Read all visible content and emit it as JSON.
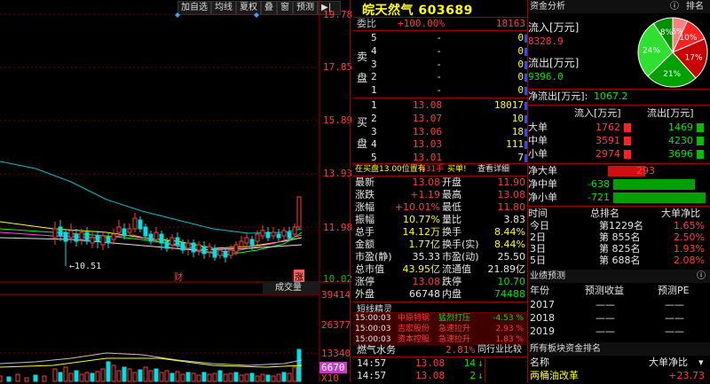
{
  "toolbar": {
    "buttons": [
      "加自选",
      "均线",
      "夏权",
      "叠",
      "窗",
      "预测"
    ],
    "arrow": "▶|"
  },
  "kchart": {
    "price_axis": [
      "19.78",
      "17.85",
      "15.89",
      "13.93",
      "11.98",
      "10.02"
    ],
    "low_label": "←10.51",
    "mark_cai": "财",
    "mark_zhang": "涨",
    "vol_title": "成交量",
    "vol_axis": [
      "39414",
      "26377",
      "13340",
      "6670",
      "X10"
    ]
  },
  "quote": {
    "title": "皖天然气 603689",
    "weibi": {
      "label": "委比",
      "pct": "+100.00%",
      "val": "18163"
    },
    "sell": [
      {
        "n": "5",
        "p": "-",
        "v": "0"
      },
      {
        "n": "4",
        "p": "-",
        "v": "0"
      },
      {
        "n": "3",
        "p": "-",
        "v": "0"
      },
      {
        "n": "2",
        "p": "-",
        "v": "0"
      },
      {
        "n": "1",
        "p": "-",
        "v": "0"
      }
    ],
    "sell_label": [
      "卖",
      "盘"
    ],
    "buy_label": [
      "买",
      "盘"
    ],
    "buy": [
      {
        "n": "1",
        "p": "13.08",
        "v": "18017"
      },
      {
        "n": "2",
        "p": "13.07",
        "v": "10"
      },
      {
        "n": "3",
        "p": "13.06",
        "v": "18"
      },
      {
        "n": "4",
        "p": "13.03",
        "v": "111"
      },
      {
        "n": "5",
        "p": "13.01",
        "v": "7"
      }
    ],
    "notice": {
      "a": "在买盘13.00位置有",
      "b": "631手",
      "c": "买单!",
      "d": "查看详细"
    },
    "stats": [
      [
        "最新",
        "13.08",
        "开盘",
        "11.90"
      ],
      [
        "涨跌",
        "+1.19",
        "最高",
        "13.08"
      ],
      [
        "涨幅",
        "+10.01%",
        "最低",
        "11.80"
      ],
      [
        "振幅",
        "10.77%",
        "量比",
        "3.83"
      ],
      [
        "总手",
        "14.12万",
        "换手",
        "8.44%"
      ],
      [
        "金额",
        "1.77亿",
        "换手(实)",
        "8.44%"
      ],
      [
        "市盈(静)",
        "35.33",
        "市盈(动)",
        "25.50"
      ],
      [
        "总市值",
        "43.95亿",
        "流通值",
        "21.89亿"
      ],
      [
        "涨停",
        "13.08",
        "跌停",
        "10.70"
      ],
      [
        "外盘",
        "66748",
        "内盘",
        "74488"
      ]
    ],
    "short": {
      "title": "短线精灵",
      "rows": [
        [
          "15:00:03",
          "中原特钢",
          "猛烈打压",
          "-4.53 %"
        ],
        [
          "15:00:03",
          "吉宏股份",
          "急速拉升",
          "2.93 %"
        ],
        [
          "15:00:03",
          "资本控股",
          "急速拉升",
          "1.83 %"
        ]
      ]
    },
    "sector": {
      "name": "燃气水务",
      "pct": "2.81%",
      "cmp": "同行业比较"
    },
    "ticks": [
      [
        "14:57",
        "13.08",
        "14"
      ],
      [
        "14:57",
        "13.08",
        "2"
      ]
    ]
  },
  "fund": {
    "title": "资金分析",
    "rank": "排名",
    "pie": [
      {
        "label": "6%",
        "v": 6,
        "color": "#ff8080"
      },
      {
        "label": "10%",
        "v": 10,
        "color": "#ff2020"
      },
      {
        "label": "17%",
        "v": 17,
        "color": "#c80000"
      },
      {
        "label": "21%",
        "v": 21,
        "color": "#00a000"
      },
      {
        "label": "24%",
        "v": 24,
        "color": "#30e030"
      },
      {
        "label": "8%",
        "v": 8,
        "color": "#009000"
      }
    ],
    "inflow_label": "流入[万元]",
    "inflow": "8328.9",
    "outflow_label": "流出[万元]",
    "outflow": "9396.0",
    "net_label": "净流出[万元]:",
    "net": "1067.2",
    "tbl_head": [
      "流入[万元]",
      "流出[万元]"
    ],
    "tbl": [
      [
        "大单",
        "1762",
        "1469"
      ],
      [
        "中单",
        "3591",
        "4230"
      ],
      [
        "小单",
        "2974",
        "3696"
      ]
    ],
    "net_rows": [
      [
        "净大单",
        "293"
      ],
      [
        "净中单",
        "-638"
      ],
      [
        "净小单",
        "-721"
      ]
    ],
    "rank_head": [
      "时间",
      "总排名",
      "大单净比"
    ],
    "ranks": [
      [
        "今日",
        "第1229名",
        "1.65%"
      ],
      [
        "2日",
        "第 855名",
        "2.50%"
      ],
      [
        "3日",
        "第 825名",
        "1.93%"
      ],
      [
        "5日",
        "第 688名",
        "2.08%"
      ]
    ],
    "perf": {
      "title": "业绩预测",
      "head": [
        "年份",
        "预测收益",
        "预测PE"
      ],
      "rows": [
        [
          "2017",
          "——",
          "——"
        ],
        [
          "2018",
          "——",
          "——"
        ],
        [
          "2019",
          "——",
          "——"
        ]
      ]
    },
    "plate": {
      "title": "所有板块资金排名",
      "head": [
        "名称",
        "大单净比"
      ],
      "row": [
        "两桶油改革",
        "+23.73"
      ]
    }
  }
}
